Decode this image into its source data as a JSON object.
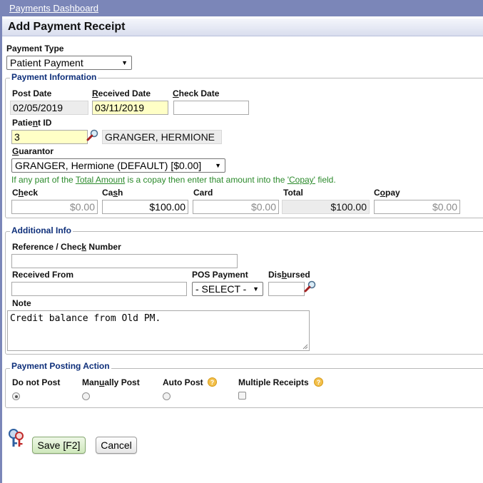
{
  "header": {
    "dashboard_link": "Payments Dashboard",
    "title": "Add Payment Receipt"
  },
  "payment_type": {
    "label": "Payment Type",
    "selected": "Patient Payment"
  },
  "payment_information": {
    "legend": "Payment Information",
    "post_date": {
      "label": "Post Date",
      "value": "02/05/2019"
    },
    "received_date": {
      "label": "Received Date",
      "value": "03/11/2019"
    },
    "check_date": {
      "label": "Check Date",
      "value": ""
    },
    "patient_id": {
      "label": "Patient ID",
      "value": "3",
      "name": "GRANGER, HERMIONE"
    },
    "guarantor": {
      "label": "Guarantor",
      "selected": "GRANGER, Hermione (DEFAULT) [$0.00]"
    },
    "copay_hint": {
      "prefix": "If any part of the ",
      "link1": "Total Amount",
      "middle": " is a copay then enter that amount into the ",
      "link2": "'Copay'",
      "suffix": " field."
    },
    "amounts": {
      "check": {
        "label": "Check",
        "value": "$0.00"
      },
      "cash": {
        "label": "Cash",
        "value": "$100.00"
      },
      "card": {
        "label": "Card",
        "value": "$0.00"
      },
      "total": {
        "label": "Total",
        "value": "$100.00"
      },
      "copay": {
        "label": "Copay",
        "value": "$0.00"
      }
    }
  },
  "additional_info": {
    "legend": "Additional Info",
    "reference": {
      "label": "Reference / Check Number",
      "value": ""
    },
    "received_from": {
      "label": "Received From",
      "value": ""
    },
    "pos_payment": {
      "label": "POS Payment",
      "selected": "- SELECT -"
    },
    "disbursed": {
      "label": "Disbursed",
      "value": ""
    },
    "note": {
      "label": "Note",
      "value": "Credit balance from Old PM."
    }
  },
  "posting_action": {
    "legend": "Payment Posting Action",
    "options": {
      "do_not_post": "Do not Post",
      "manually_post": "Manually Post",
      "auto_post": "Auto Post",
      "multiple_receipts": "Multiple Receipts"
    },
    "selected": "Do not Post",
    "help_glyph": "?"
  },
  "actions": {
    "save": "Save [F2]",
    "cancel": "Cancel"
  }
}
